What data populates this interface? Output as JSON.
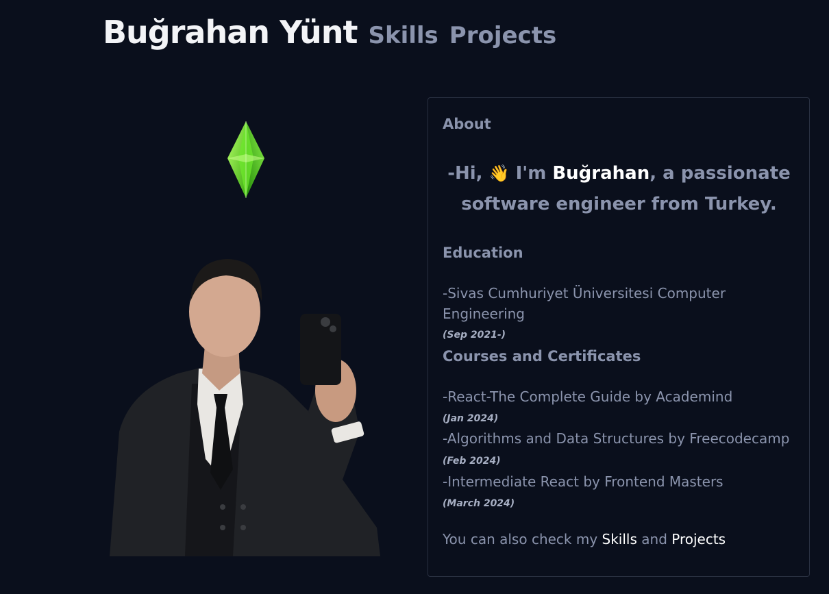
{
  "header": {
    "brand": "Buğrahan Yünt",
    "nav": [
      {
        "label": "Skills"
      },
      {
        "label": "Projects"
      }
    ]
  },
  "about": {
    "title": "About",
    "intro_prefix": "-Hi, ",
    "wave": "👋",
    "intro_im": " I'm ",
    "name": "Buğrahan",
    "intro_suffix": ", a passionate software engineer from Turkey."
  },
  "education": {
    "title": "Education",
    "items": [
      {
        "text": "-Sivas Cumhuriyet Üniversitesi Computer Engineering",
        "date": "(Sep 2021-)"
      }
    ]
  },
  "courses": {
    "title": "Courses and Certificates",
    "items": [
      {
        "text": "-React-The Complete Guide by Academind",
        "date": "(Jan 2024)"
      },
      {
        "text": "-Algorithms and Data Structures by Freecodecamp",
        "date": "(Feb 2024)"
      },
      {
        "text": "-Intermediate React by Frontend Masters",
        "date": "(March 2024)"
      }
    ]
  },
  "cta": {
    "prefix": "You can also check my ",
    "skills": "Skills",
    "and": " and ",
    "projects": "Projects"
  },
  "colors": {
    "background": "#0a0f1c",
    "text_muted": "#8b94ad",
    "text_bright": "#ffffff",
    "plumbob": "#5fe82a",
    "card_border": "#2a3142"
  },
  "icons": {
    "plumbob": "plumbob-gem-icon"
  }
}
